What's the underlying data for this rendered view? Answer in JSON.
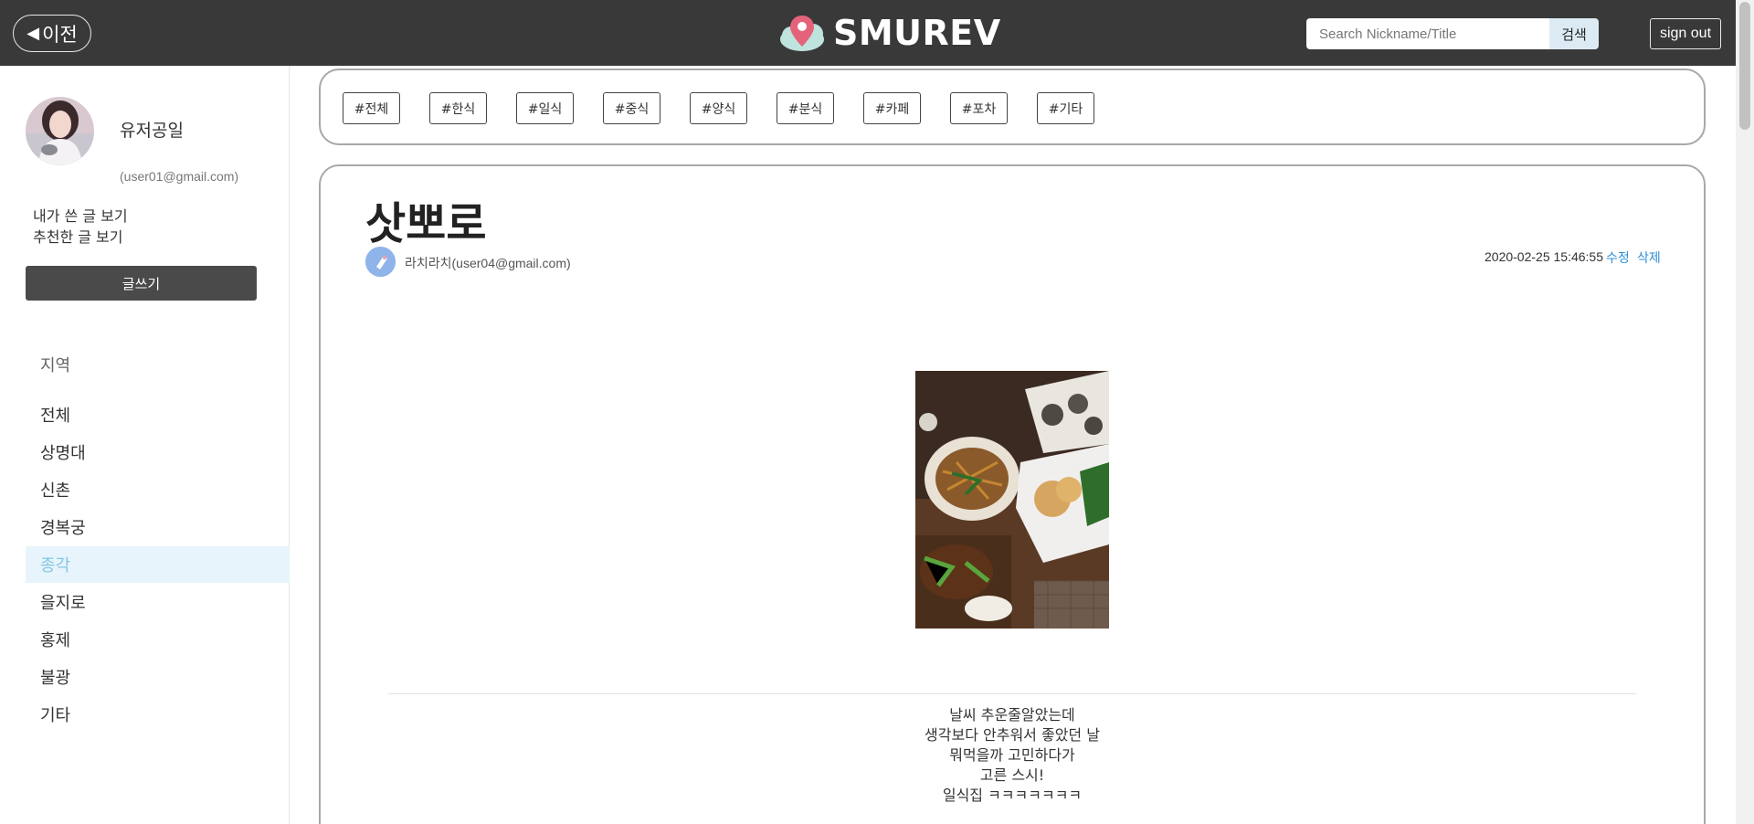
{
  "header": {
    "back_label": "이전",
    "brand": "SMUREV",
    "search_placeholder": "Search Nickname/Title",
    "search_button": "검색",
    "signout_label": "sign out"
  },
  "sidebar": {
    "username": "유저공일",
    "email": "(user01@gmail.com)",
    "my_posts": "내가 쓴 글 보기",
    "recommended_posts": "추천한 글 보기",
    "write_button": "글쓰기",
    "region_title": "지역",
    "regions": [
      {
        "label": "전체",
        "active": false
      },
      {
        "label": "상명대",
        "active": false
      },
      {
        "label": "신촌",
        "active": false
      },
      {
        "label": "경복궁",
        "active": false
      },
      {
        "label": "종각",
        "active": true
      },
      {
        "label": "을지로",
        "active": false
      },
      {
        "label": "홍제",
        "active": false
      },
      {
        "label": "불광",
        "active": false
      },
      {
        "label": "기타",
        "active": false
      }
    ]
  },
  "categories": [
    "#전체",
    "#한식",
    "#일식",
    "#중식",
    "#양식",
    "#분식",
    "#카페",
    "#포차",
    "#기타"
  ],
  "post": {
    "title": "삿뽀로",
    "author": "라치라치(user04@gmail.com)",
    "date": "2020-02-25 15:46:55",
    "edit_label": "수정",
    "delete_label": "삭제",
    "body_lines": [
      "날씨 추운줄알았는데",
      "생각보다 안추워서 좋았던 날",
      "뭐먹을까 고민하다가",
      "고른 스시!",
      "일식집 ㅋㅋㅋㅋㅋㅋㅋ"
    ]
  },
  "colors": {
    "header_bg": "#393939",
    "active_region_bg": "#e7f4fb",
    "active_region_text": "#82c7e6",
    "link_blue": "#2f8fd8",
    "write_button_bg": "#4a4a4a"
  }
}
